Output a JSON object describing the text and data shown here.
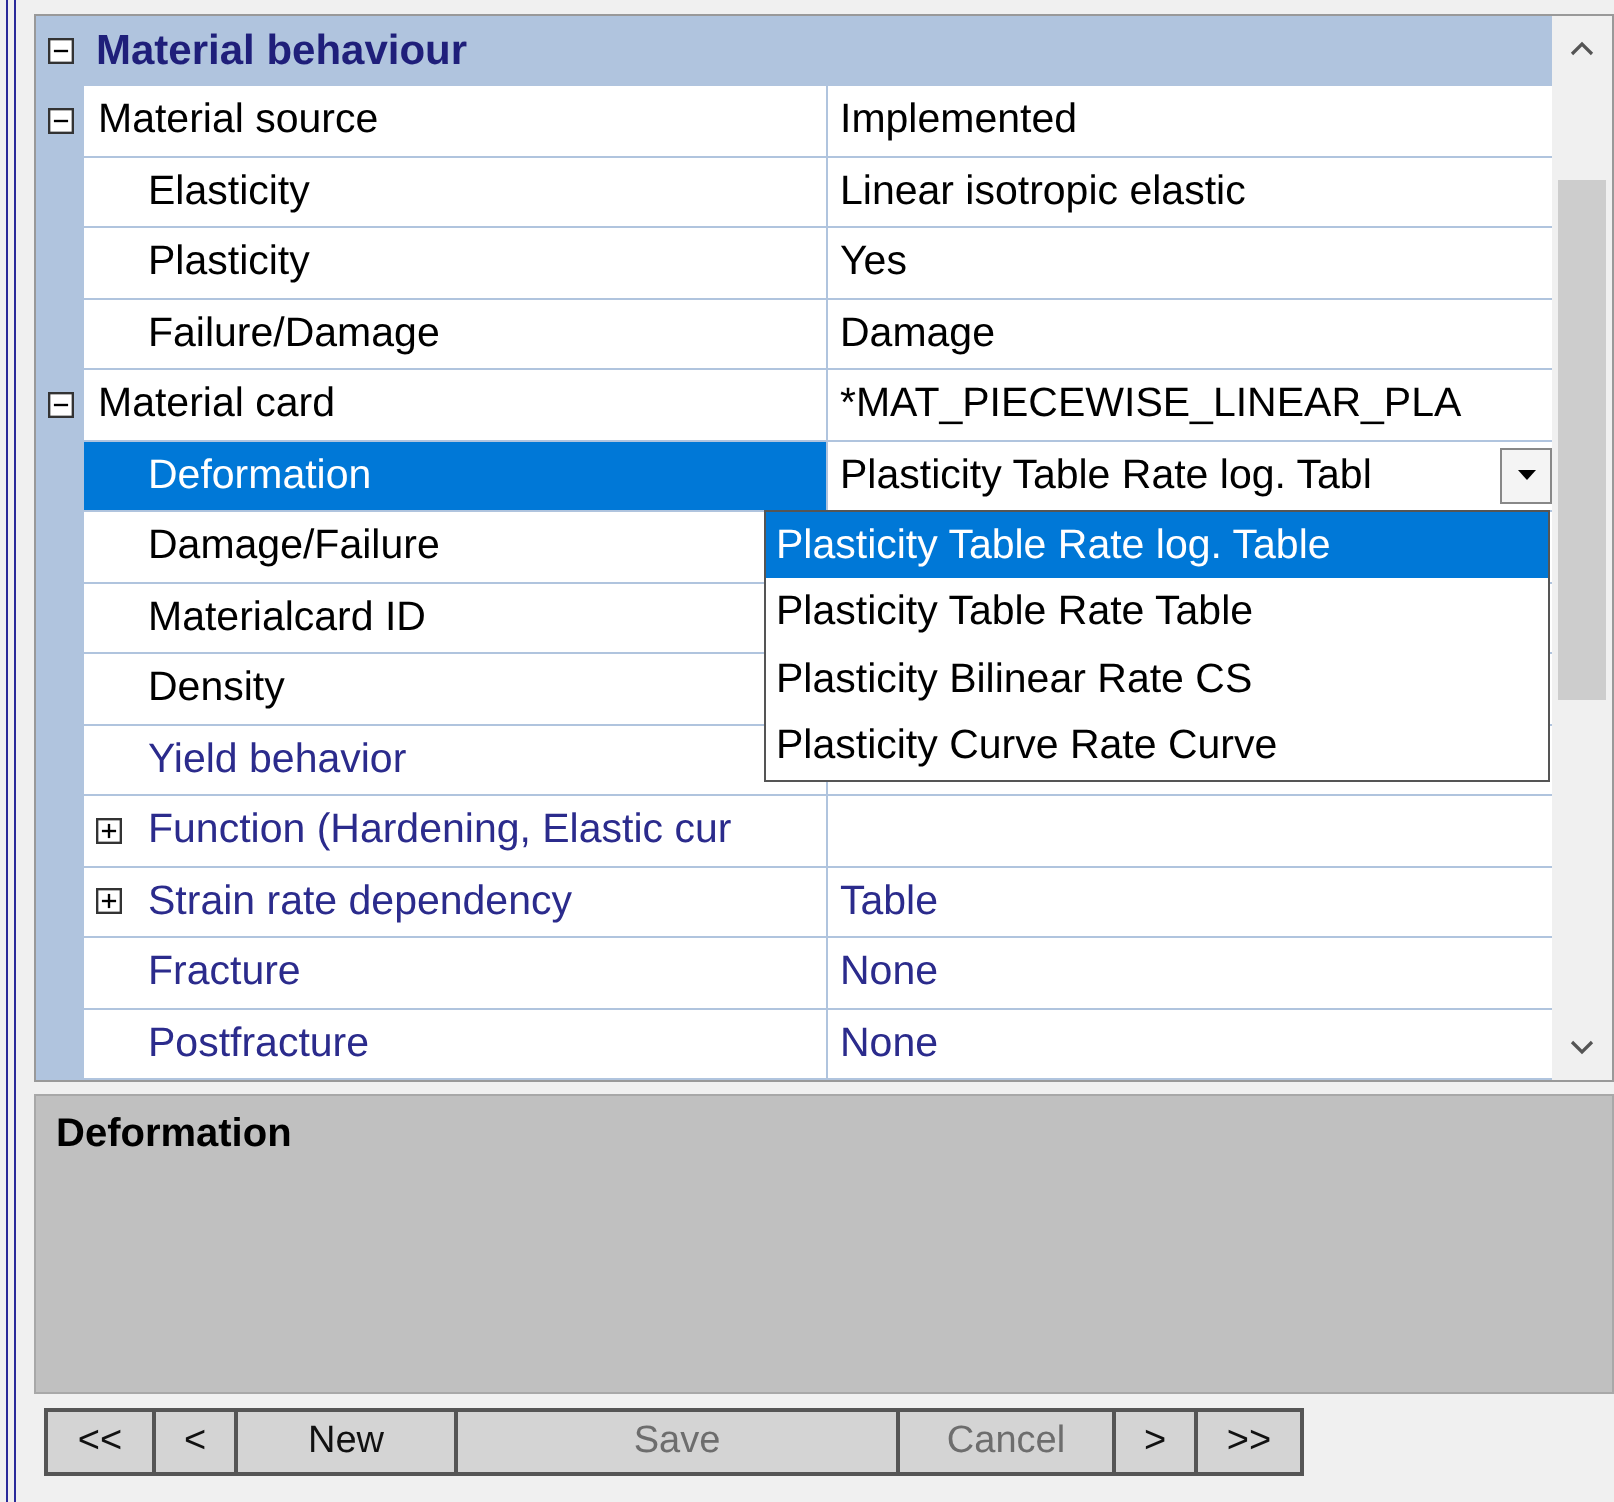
{
  "category": {
    "title": "Material behaviour",
    "expanded": true,
    "items": [
      {
        "name": "Material source",
        "value": "Implemented",
        "color": "#000000",
        "expanded": true,
        "selected": false,
        "children": [
          {
            "name": "Elasticity",
            "value": "Linear isotropic elastic",
            "color": "#000000",
            "selected": false
          },
          {
            "name": "Plasticity",
            "value": "Yes",
            "color": "#000000",
            "selected": false
          },
          {
            "name": "Failure/Damage",
            "value": "Damage",
            "color": "#000000",
            "selected": false
          }
        ]
      },
      {
        "name": "Material card",
        "value": "*MAT_PIECEWISE_LINEAR_PLA",
        "color": "#000000",
        "expanded": true,
        "selected": false,
        "children": [
          {
            "name": "Deformation",
            "value": "Plasticity Table Rate log. Tabl",
            "selected": true,
            "options": [
              {
                "label": "Plasticity Table Rate log. Table",
                "selected": true
              },
              {
                "label": "Plasticity Table Rate Table",
                "selected": false
              },
              {
                "label": "Plasticity Bilinear Rate CS",
                "selected": false
              },
              {
                "label": "Plasticity Curve Rate Curve",
                "selected": false
              }
            ]
          },
          {
            "name": "Damage/Failure",
            "color": "#000000",
            "selected": false
          },
          {
            "name": "Materialcard ID",
            "color": "#000000",
            "selected": false
          },
          {
            "name": "Density",
            "color": "#000000",
            "selected": false
          },
          {
            "name": "Yield behavior",
            "color": "#2b2b8c",
            "selected": false
          },
          {
            "name": "Function (Hardening, Elastic cur",
            "color": "#2b2b8c",
            "expanded": false,
            "selected": false
          },
          {
            "name": "Strain rate dependency",
            "value": "Table",
            "color": "#2b2b8c",
            "expanded": false,
            "selected": false
          },
          {
            "name": "Fracture",
            "value": "None",
            "color": "#2b2b8c",
            "selected": false
          },
          {
            "name": "Postfracture",
            "value": "None",
            "color": "#2b2b8c",
            "selected": false
          }
        ]
      }
    ]
  },
  "description": {
    "title": "Deformation"
  },
  "buttons": [
    {
      "label": "<<",
      "disabled": false
    },
    {
      "label": "<",
      "disabled": false
    },
    {
      "label": "New",
      "disabled": false
    },
    {
      "label": "Save",
      "disabled": true
    },
    {
      "label": "Cancel",
      "disabled": true
    },
    {
      "label": ">",
      "disabled": false
    },
    {
      "label": ">>",
      "disabled": false
    }
  ]
}
